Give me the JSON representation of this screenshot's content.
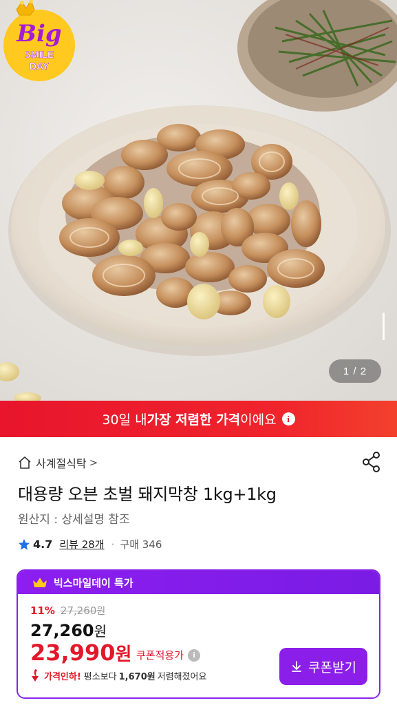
{
  "image_counter": "1 / 2",
  "badge": {
    "line1": "Big",
    "line2": "SMILE",
    "line3": "DAY"
  },
  "banner": {
    "prefix": "30일 내 ",
    "highlight": "가장 저렴한 가격",
    "suffix": "이에요",
    "info": "i"
  },
  "breadcrumb": {
    "category": "사계절식탁",
    "chevron": ">"
  },
  "product": {
    "title": "대용량 오븐 초벌 돼지막창 1kg+1kg",
    "origin": "원산지 : 상세설명 참조"
  },
  "rating": {
    "score": "4.7",
    "review_label": "리뷰 28개",
    "separator": "·",
    "purchase_label": "구매 346"
  },
  "price_card": {
    "header": "빅스마일데이 특가",
    "discount_pct": "11%",
    "original_price": "27,260",
    "original_won": "원",
    "price": "27,260",
    "price_won": "원",
    "coupon_price": "23,990",
    "coupon_won": "원",
    "coupon_label": "쿠폰적용가",
    "info": "i",
    "drop_red": "가격인하!",
    "drop_text1": "평소보다",
    "drop_amount": "1,670원",
    "drop_text2": "저렴해졌어요",
    "coupon_button": "쿠폰받기"
  },
  "colors": {
    "accent_red": "#e3172b",
    "purple": "#8b1ee8",
    "banner_red": "#e8152c"
  }
}
